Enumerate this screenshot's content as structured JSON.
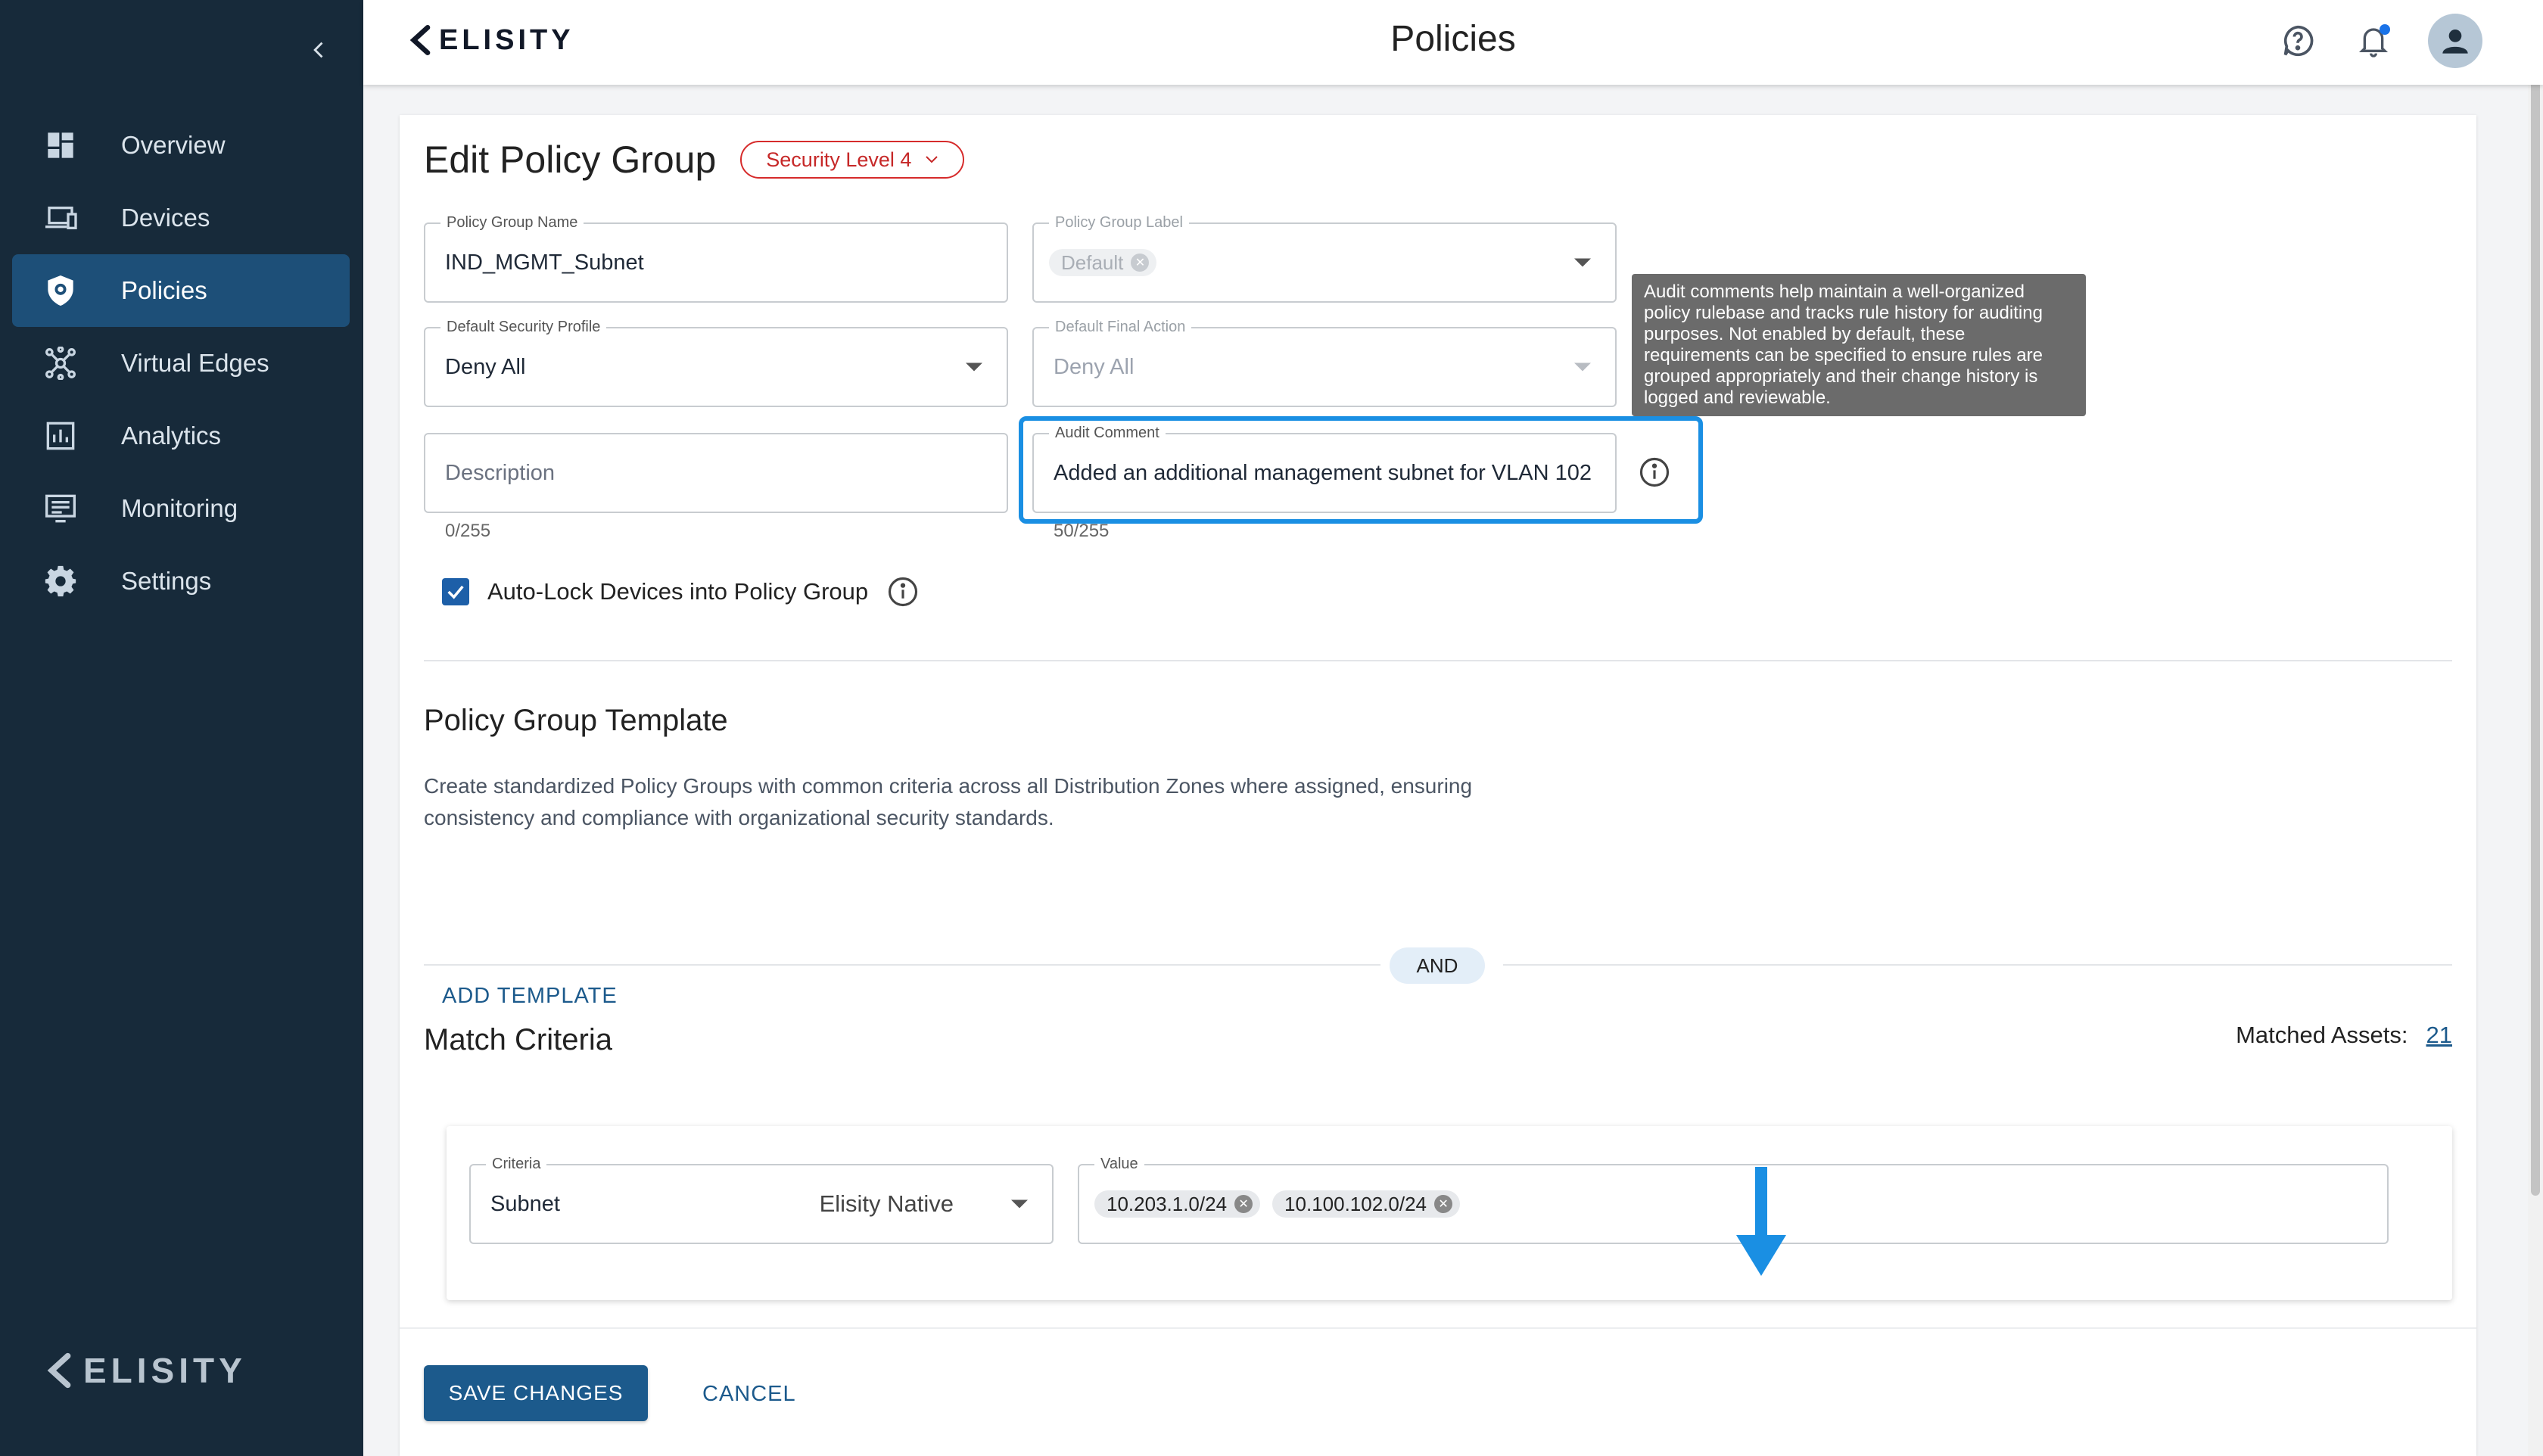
{
  "app": {
    "brand": "ELISITY",
    "page_title": "Policies"
  },
  "sidebar": {
    "items": [
      {
        "label": "Overview",
        "icon": "grid-icon",
        "active": false
      },
      {
        "label": "Devices",
        "icon": "devices-icon",
        "active": false
      },
      {
        "label": "Policies",
        "icon": "shield-icon",
        "active": true
      },
      {
        "label": "Virtual Edges",
        "icon": "network-icon",
        "active": false
      },
      {
        "label": "Analytics",
        "icon": "chart-icon",
        "active": false
      },
      {
        "label": "Monitoring",
        "icon": "monitor-icon",
        "active": false
      },
      {
        "label": "Settings",
        "icon": "gear-icon",
        "active": false
      }
    ],
    "footer_brand": "ELISITY"
  },
  "form": {
    "title": "Edit Policy Group",
    "security_level": "Security Level 4",
    "policy_group_name": {
      "label": "Policy Group Name",
      "value": "IND_MGMT_Subnet"
    },
    "policy_group_label": {
      "label": "Policy Group Label",
      "chip": "Default"
    },
    "default_security_profile": {
      "label": "Default Security Profile",
      "value": "Deny All"
    },
    "default_final_action": {
      "label": "Default Final Action",
      "value": "Deny All"
    },
    "description": {
      "placeholder": "Description",
      "counter": "0/255"
    },
    "audit_comment": {
      "label": "Audit Comment",
      "value": "Added an additional management subnet for VLAN 102",
      "counter": "50/255"
    },
    "tooltip": "Audit comments help maintain a well-organized policy rulebase and tracks rule history for auditing purposes. Not enabled by default, these requirements can be specified to ensure rules are grouped appropriately and their change history is logged and reviewable.",
    "auto_lock_label": "Auto-Lock Devices into Policy Group"
  },
  "template_section": {
    "title": "Policy Group Template",
    "description": "Create standardized Policy Groups with common criteria across all Distribution Zones where assigned, ensuring consistency and compliance with organizational security standards.",
    "add_button": "ADD TEMPLATE"
  },
  "and_label": "AND",
  "match_criteria": {
    "title": "Match Criteria",
    "matched_assets_label": "Matched Assets:",
    "matched_assets_count": "21",
    "criteria": {
      "label": "Criteria",
      "value": "Subnet",
      "source": "Elisity Native"
    },
    "value_field": {
      "label": "Value",
      "chips": [
        "10.203.1.0/24",
        "10.100.102.0/24"
      ]
    }
  },
  "actions": {
    "save": "SAVE CHANGES",
    "cancel": "CANCEL"
  },
  "colors": {
    "sidebar_bg": "#172a3a",
    "active_nav": "#1d4f78",
    "primary": "#1c5a8c",
    "highlight": "#1a8fe3",
    "danger": "#d62b2b"
  }
}
